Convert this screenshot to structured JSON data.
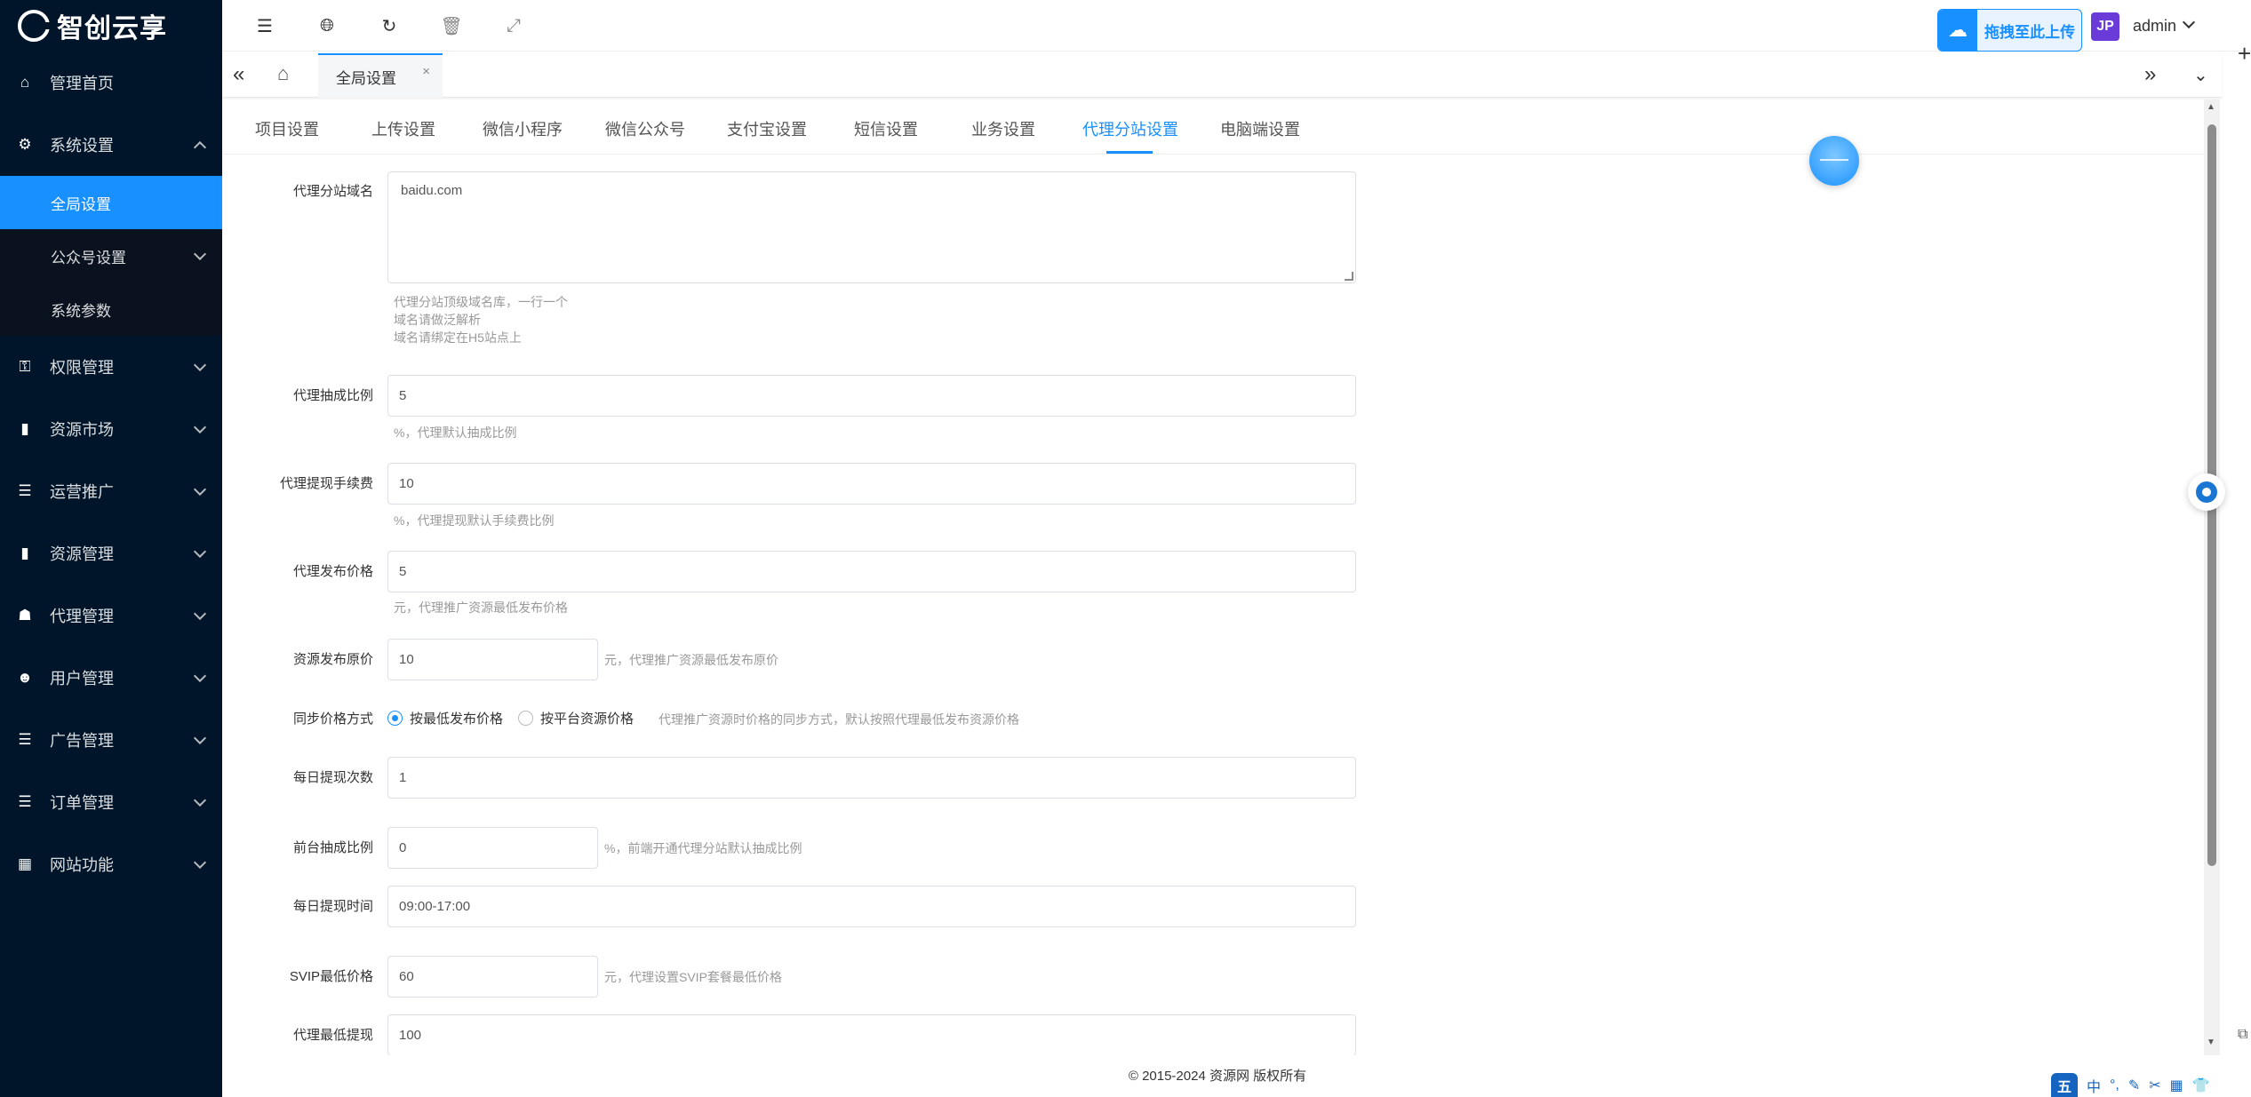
{
  "brand": {
    "name": "智创云享"
  },
  "sidebar": {
    "items": [
      {
        "label": "管理首页",
        "icon": "home-icon",
        "expandable": false
      },
      {
        "label": "系统设置",
        "icon": "gear-icon",
        "expandable": true,
        "open": true,
        "children": [
          {
            "label": "全局设置",
            "active": true
          },
          {
            "label": "公众号设置",
            "expandable": true
          },
          {
            "label": "系统参数"
          }
        ]
      },
      {
        "label": "权限管理",
        "icon": "user-lock-icon",
        "expandable": true
      },
      {
        "label": "资源市场",
        "icon": "book-icon",
        "expandable": true
      },
      {
        "label": "运营推广",
        "icon": "list-icon",
        "expandable": true
      },
      {
        "label": "资源管理",
        "icon": "book-icon",
        "expandable": true
      },
      {
        "label": "代理管理",
        "icon": "users-icon",
        "expandable": true
      },
      {
        "label": "用户管理",
        "icon": "user-icon",
        "expandable": true
      },
      {
        "label": "广告管理",
        "icon": "list-icon",
        "expandable": true
      },
      {
        "label": "订单管理",
        "icon": "list-icon",
        "expandable": true
      },
      {
        "label": "网站功能",
        "icon": "grid-icon",
        "expandable": true
      }
    ]
  },
  "header": {
    "upload_label": "拖拽至此上传",
    "avatar_text": "JP",
    "user_name": "admin"
  },
  "tabs": {
    "open_tabs": [
      {
        "label": "全局设置",
        "closable": true
      }
    ]
  },
  "settings": {
    "subtabs": [
      "项目设置",
      "上传设置",
      "微信小程序",
      "微信公众号",
      "支付宝设置",
      "短信设置",
      "业务设置",
      "代理分站设置",
      "电脑端设置"
    ],
    "active_subtab": "代理分站设置",
    "fields": {
      "domain": {
        "label": "代理分站域名",
        "value": "baidu.com",
        "hints": [
          "代理分站顶级域名库，一行一个",
          "域名请做泛解析",
          "域名请绑定在H5站点上"
        ]
      },
      "commission_rate": {
        "label": "代理抽成比例",
        "value": "5",
        "hint": "%，代理默认抽成比例"
      },
      "withdraw_fee": {
        "label": "代理提现手续费",
        "value": "10",
        "hint": "%，代理提现默认手续费比例"
      },
      "publish_price": {
        "label": "代理发布价格",
        "value": "5",
        "hint": "元，代理推广资源最低发布价格"
      },
      "resource_price": {
        "label": "资源发布原价",
        "value": "10",
        "hint": "元，代理推广资源最低发布原价"
      },
      "sync_method": {
        "label": "同步价格方式",
        "options": [
          "按最低发布价格",
          "按平台资源价格"
        ],
        "selected": "按最低发布价格",
        "hint": "代理推广资源时价格的同步方式，默认按照代理最低发布资源价格"
      },
      "daily_withdraw_count": {
        "label": "每日提现次数",
        "value": "1"
      },
      "front_commission": {
        "label": "前台抽成比例",
        "value": "0",
        "hint": "%，前端开通代理分站默认抽成比例"
      },
      "withdraw_time": {
        "label": "每日提现时间",
        "value": "09:00-17:00"
      },
      "svip_min_price": {
        "label": "SVIP最低价格",
        "value": "60",
        "hint": "元，代理设置SVIP套餐最低价格"
      },
      "min_withdraw": {
        "label": "代理最低提现",
        "value": "100"
      }
    }
  },
  "footer": {
    "text": "© 2015-2024 资源网 版权所有"
  },
  "ime": {
    "logo": "五",
    "items": [
      "中",
      "°,",
      "✎",
      "✂",
      "▦",
      "👕"
    ]
  },
  "colors": {
    "sidebar_bg": "#001529",
    "accent": "#1890ff"
  }
}
